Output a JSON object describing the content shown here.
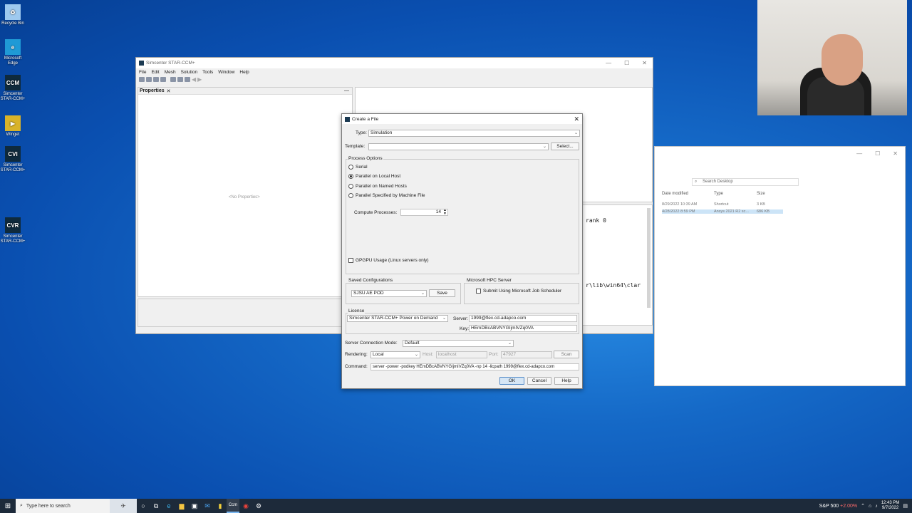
{
  "desktop_icons": [
    {
      "label": "Recycle Bin",
      "icon": "recycle-bin-icon",
      "color": "#9ec9ef",
      "glyph": "♻"
    },
    {
      "label": "Microsoft Edge",
      "icon": "edge-icon",
      "color": "#1f9ad6",
      "glyph": "e"
    },
    {
      "label": "Simcenter STAR-CCM+",
      "icon": "star-ccm-icon",
      "color": "#0f2a3c",
      "glyph": "CCM"
    },
    {
      "label": "Winget",
      "icon": "winget-icon",
      "color": "#d8b32a",
      "glyph": "▶"
    },
    {
      "label": "Simcenter STAR-CCM+",
      "icon": "star-cvi-icon",
      "color": "#0f2a3c",
      "glyph": "CVI"
    },
    {
      "label": "Simcenter STAR-CCM+",
      "icon": "star-cvr-icon",
      "color": "#0f2a3c",
      "glyph": "CVR"
    }
  ],
  "main_window": {
    "title": "Simcenter STAR-CCM+",
    "menu": [
      "File",
      "Edit",
      "Mesh",
      "Solution",
      "Tools",
      "Window",
      "Help"
    ],
    "properties_tab": "Properties",
    "no_properties": "<No Properties>",
    "output_lines": [
      "rank 0",
      "r\\lib\\win64\\clar"
    ]
  },
  "explorer": {
    "search_placeholder": "Search Desktop",
    "columns": [
      "Date modified",
      "Type",
      "Size"
    ],
    "rows": [
      {
        "date": "8/29/2022 10:39 AM",
        "type": "Shortcut",
        "size": "3 KB"
      },
      {
        "date": "4/28/2022 8:59 PM",
        "type": "Ansys 2021 R2 sc...",
        "size": "686 KB"
      }
    ]
  },
  "dialog": {
    "title": "Create a File",
    "type_label": "Type:",
    "type_value": "Simulation",
    "template_label": "Template:",
    "template_value": "",
    "select_button": "Select...",
    "process_options_title": "Process Options",
    "process_options": [
      {
        "label": "Serial",
        "selected": false
      },
      {
        "label": "Parallel on Local Host",
        "selected": true
      },
      {
        "label": "Parallel on Named Hosts",
        "selected": false
      },
      {
        "label": "Parallel Specified by Machine File",
        "selected": false
      }
    ],
    "compute_processes_label": "Compute Processes:",
    "compute_processes_value": "14",
    "gpgpu_label": "GPGPU Usage (Linux servers only)",
    "saved_configs_title": "Saved Configurations",
    "saved_config_value": "SJSU AE POD",
    "save_button": "Save",
    "hpc_title": "Microsoft HPC Server",
    "hpc_checkbox": "Submit Using Microsoft Job Scheduler",
    "license_title": "License",
    "license_value": "Simcenter STAR-CCM+ Power on Demand",
    "server_label": "Server:",
    "server_value": "1999@flex.cd-adapco.com",
    "key_label": "Key:",
    "key_value": "HEmDBcABVNYGIjmIVZq0VA",
    "server_conn_label": "Server Connection Mode:",
    "server_conn_value": "Default",
    "rendering_label": "Rendering:",
    "rendering_value": "Local",
    "host_label": "Host:",
    "host_value": "localhost",
    "port_label": "Port:",
    "port_value": "47927",
    "scan_button": "Scan",
    "command_label": "Command:",
    "command_value": "server -power -podkey HEmDBcABVNYGIjmIVZq0VA -np 14 -licpath 1999@flex.cd-adapco.com",
    "ok_button": "OK",
    "cancel_button": "Cancel",
    "help_button": "Help"
  },
  "taskbar": {
    "search_placeholder": "Type here to search",
    "stock": "S&P 500",
    "stock_change": "+2.00%",
    "time": "12:43 PM",
    "date": "9/7/2022"
  }
}
